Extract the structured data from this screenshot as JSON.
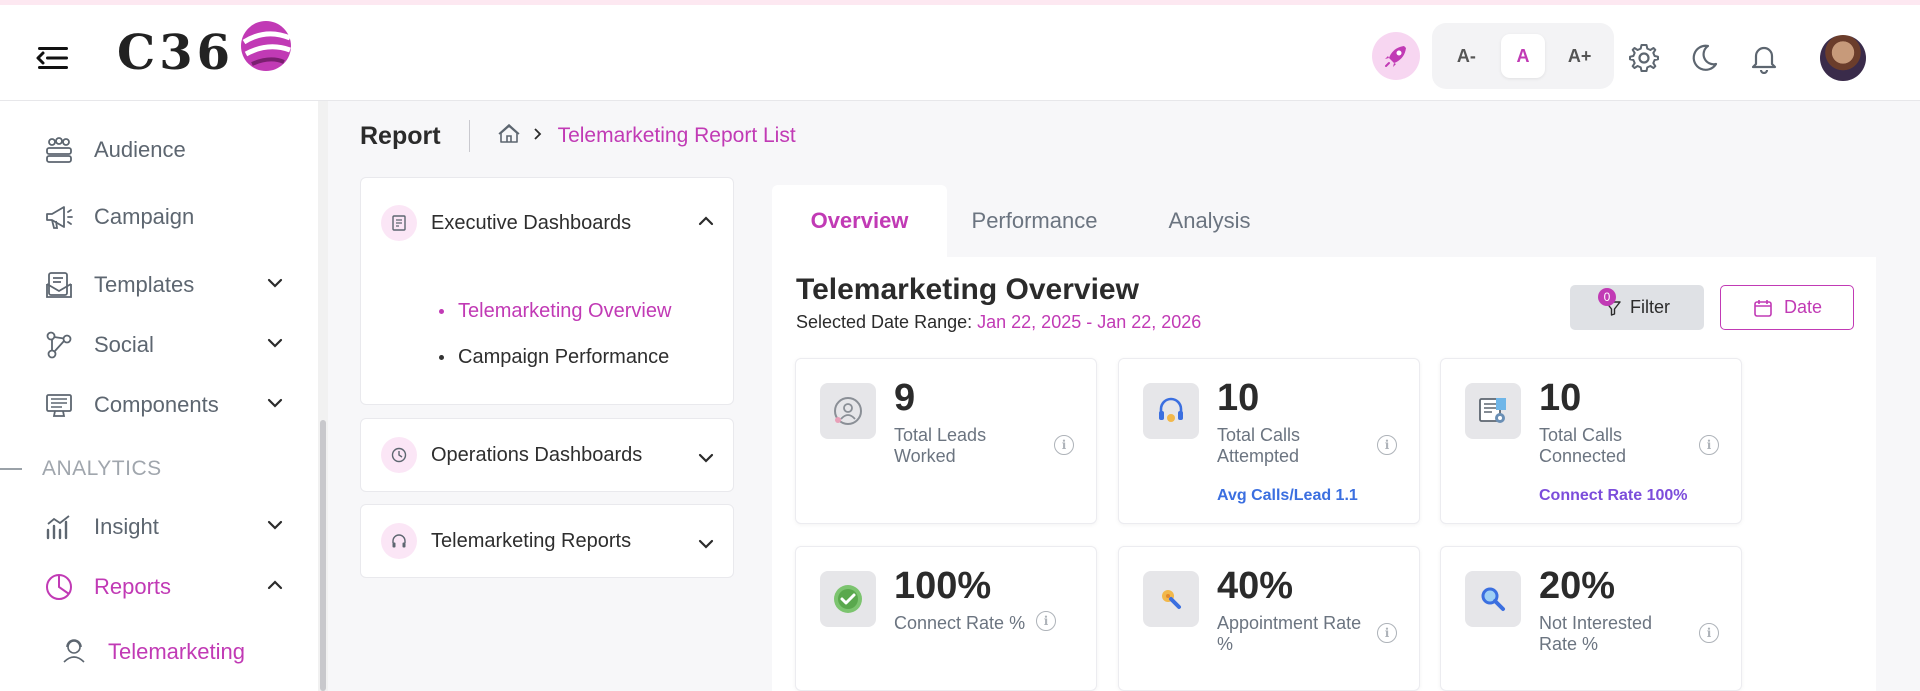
{
  "header": {
    "logo_text": "C36",
    "font_sizes": [
      "A-",
      "A",
      "A+"
    ],
    "colors": {
      "accent": "#c13ab5",
      "rocket_bg": "#f7d6f1"
    }
  },
  "sidebar": {
    "items": [
      {
        "label": "Audience",
        "icon": "audience-icon"
      },
      {
        "label": "Campaign",
        "icon": "megaphone-icon"
      },
      {
        "label": "Templates",
        "icon": "template-icon"
      },
      {
        "label": "Social",
        "icon": "share-icon"
      },
      {
        "label": "Components",
        "icon": "components-icon"
      },
      {
        "label": "Insight",
        "icon": "chart-icon"
      },
      {
        "label": "Reports",
        "icon": "pie-chart-icon"
      }
    ],
    "section_label": "ANALYTICS",
    "sub_item": "Telemarketing"
  },
  "breadcrumb": {
    "title": "Report",
    "current": "Telemarketing Report List"
  },
  "accordion": {
    "executive": {
      "label": "Executive Dashboards",
      "items": [
        "Telemarketing Overview",
        "Campaign Performance"
      ]
    },
    "operations": {
      "label": "Operations Dashboards"
    },
    "telemarketing": {
      "label": "Telemarketing Reports"
    }
  },
  "tabs": [
    "Overview",
    "Performance",
    "Analysis"
  ],
  "overview": {
    "title": "Telemarketing Overview",
    "range_label": "Selected Date Range:",
    "range_value": "Jan 22, 2025 - Jan 22, 2026",
    "filter_label": "Filter",
    "filter_count": "0",
    "date_label": "Date"
  },
  "stats": [
    {
      "value": "9",
      "label": "Total Leads Worked",
      "sub": ""
    },
    {
      "value": "10",
      "label": "Total Calls Attempted",
      "sub": "Avg Calls/Lead 1.1",
      "sub_color": "#3b6fe0"
    },
    {
      "value": "10",
      "label": "Total Calls Connected",
      "sub": "Connect Rate 100%",
      "sub_color": "#7c4ddb"
    },
    {
      "value": "100%",
      "label": "Connect Rate %",
      "sub": ""
    },
    {
      "value": "40%",
      "label": "Appointment Rate %",
      "sub": ""
    },
    {
      "value": "20%",
      "label": "Not Interested Rate %",
      "sub": ""
    }
  ]
}
